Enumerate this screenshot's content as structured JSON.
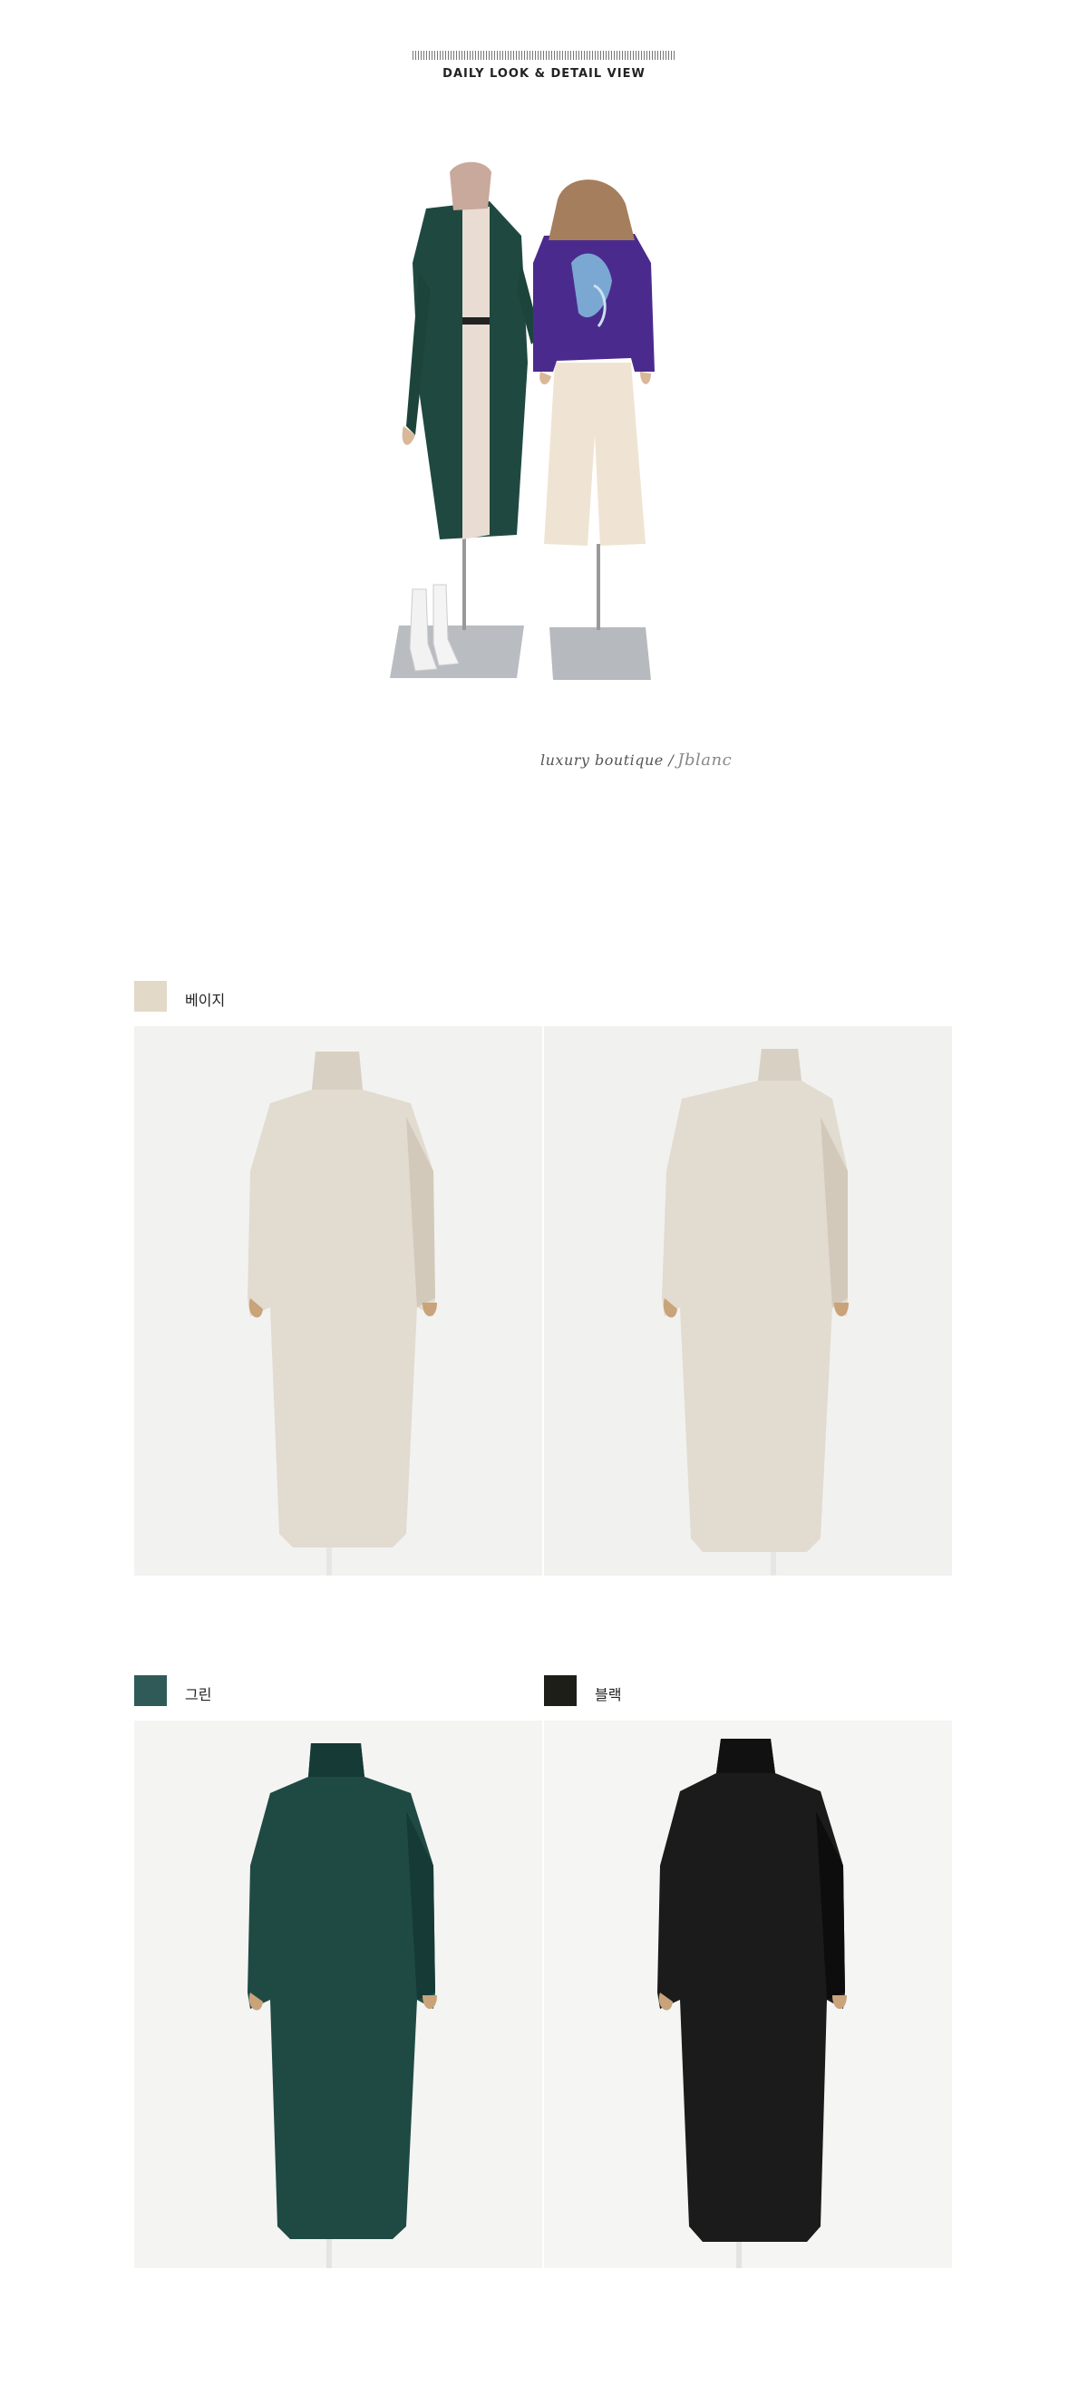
{
  "header": {
    "title": "DAILY LOOK & DETAIL VIEW"
  },
  "signature": {
    "text": "luxury boutique  /",
    "script": "Jblanc"
  },
  "colors": [
    {
      "label": "베이지",
      "hex": "#e3d9c8",
      "dress": "#e2dbcf",
      "dress_shade": "#d2c9ba",
      "photo_count": 2
    },
    {
      "label": "그린",
      "hex": "#2f5a58",
      "dress": "#1f4a44",
      "dress_shade": "#163a35",
      "photo_count": 1
    },
    {
      "label": "블랙",
      "hex": "#1e1e18",
      "dress": "#1b1b1b",
      "dress_shade": "#0d0d0d",
      "photo_count": 1
    }
  ],
  "icons": {
    "hero": "mannequin-outfits-photo",
    "dress": "turtleneck-dress-photo"
  }
}
